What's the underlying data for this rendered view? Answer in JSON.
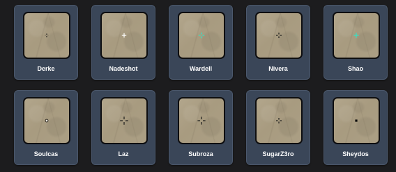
{
  "cards": [
    {
      "name": "Derke",
      "crosshair": {
        "style": "dot-gap",
        "color": "#1a1a1a"
      }
    },
    {
      "name": "Nadeshot",
      "crosshair": {
        "style": "plus",
        "color": "#ffffff"
      }
    },
    {
      "name": "Wardell",
      "crosshair": {
        "style": "plus-gap",
        "color": "#2ee6c8"
      }
    },
    {
      "name": "Nivera",
      "crosshair": {
        "style": "plus-gap",
        "color": "#1a1a1a"
      }
    },
    {
      "name": "Shao",
      "crosshair": {
        "style": "plus",
        "color": "#2ee6c8"
      }
    },
    {
      "name": "Soulcas",
      "crosshair": {
        "style": "ring-dot",
        "color": "#ffffff"
      }
    },
    {
      "name": "Laz",
      "crosshair": {
        "style": "plus-gap-large",
        "color": "#1a1a1a"
      }
    },
    {
      "name": "Subroza",
      "crosshair": {
        "style": "plus-gap-large",
        "color": "#1a1a1a"
      }
    },
    {
      "name": "SugarZ3ro",
      "crosshair": {
        "style": "plus-gap",
        "color": "#1a1a1a"
      }
    },
    {
      "name": "Sheydos",
      "crosshair": {
        "style": "dot",
        "color": "#0a0a0a"
      }
    }
  ]
}
